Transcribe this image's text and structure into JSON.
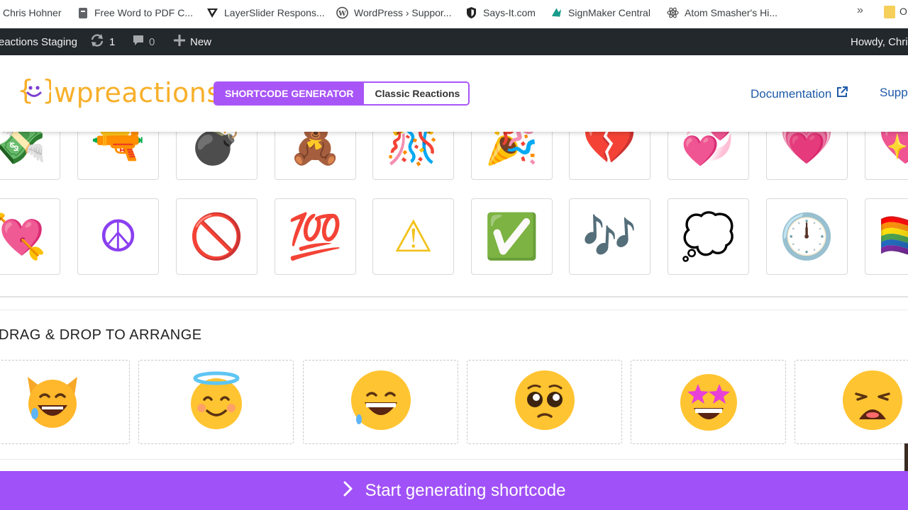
{
  "bookmarks": {
    "items": [
      {
        "label": "Chris Hohner",
        "icon": "bookmark-icon"
      },
      {
        "label": "Free Word to PDF C...",
        "icon": "pdf-icon"
      },
      {
        "label": "LayerSlider Respons...",
        "icon": "layerslider-icon"
      },
      {
        "label": "WordPress › Suppor...",
        "icon": "wordpress-icon"
      },
      {
        "label": "Says-It.com",
        "icon": "shield-icon"
      },
      {
        "label": "SignMaker Central",
        "icon": "signmaker-icon"
      },
      {
        "label": "Atom Smasher's Hi...",
        "icon": "atom-icon"
      }
    ],
    "more": "»",
    "folder_label": "O"
  },
  "adminbar": {
    "site_name": "eactions Staging",
    "updates_count": "1",
    "comments_count": "0",
    "new_label": "New",
    "howdy": "Howdy, Chri"
  },
  "header": {
    "logo_text": "wpreactions",
    "tab_active": "SHORTCODE GENERATOR",
    "tab_inactive": "Classic Reactions",
    "documentation_link": "Documentation",
    "support_link": "Supp",
    "accent_color": "#a855f7",
    "logo_color": "#f7b02b"
  },
  "picker": {
    "row1": [
      {
        "emoji": "💸",
        "name": "money-with-wings-emoji"
      },
      {
        "emoji": "🔫",
        "name": "pistol-emoji"
      },
      {
        "emoji": "💣",
        "name": "bomb-emoji"
      },
      {
        "emoji": "🧸",
        "name": "teddy-bear-emoji"
      },
      {
        "emoji": "🎊",
        "name": "confetti-ball-emoji"
      },
      {
        "emoji": "🎉",
        "name": "party-popper-emoji"
      },
      {
        "emoji": "💔",
        "name": "broken-heart-emoji"
      },
      {
        "emoji": "💞",
        "name": "revolving-hearts-emoji"
      },
      {
        "emoji": "💗",
        "name": "growing-heart-emoji"
      },
      {
        "emoji": "💖",
        "name": "sparkling-heart-emoji"
      }
    ],
    "row2": [
      {
        "emoji": "💘",
        "name": "heart-with-arrow-emoji"
      },
      {
        "emoji": "☮",
        "name": "peace-symbol-emoji"
      },
      {
        "emoji": "🚫",
        "name": "prohibited-emoji"
      },
      {
        "emoji": "💯",
        "name": "hundred-points-emoji"
      },
      {
        "emoji": "⚠",
        "name": "warning-emoji"
      },
      {
        "emoji": "✅",
        "name": "check-mark-button-emoji"
      },
      {
        "emoji": "🎶",
        "name": "musical-notes-emoji"
      },
      {
        "emoji": "💭",
        "name": "thought-balloon-emoji"
      },
      {
        "emoji": "🕛",
        "name": "twelve-oclock-emoji"
      },
      {
        "emoji": "🏳️‍🌈",
        "name": "rainbow-flag-emoji"
      }
    ]
  },
  "arrange": {
    "title": "DRAG & DROP TO ARRANGE",
    "slots": [
      {
        "name": "cat-joy-emoji"
      },
      {
        "name": "smiling-halo-emoji"
      },
      {
        "name": "grinning-sweat-emoji"
      },
      {
        "name": "pleading-face-emoji"
      },
      {
        "name": "star-struck-emoji"
      },
      {
        "name": "weary-face-emoji"
      }
    ]
  },
  "cta": {
    "label": "Start generating shortcode",
    "color": "#a051f7"
  }
}
